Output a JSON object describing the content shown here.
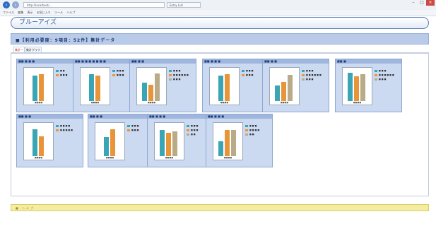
{
  "browser": {
    "address": "http://localhost/...",
    "tab_label": "Entry List",
    "menu": [
      "ファイル",
      "編集",
      "表示",
      "お気に入り",
      "ツール",
      "ヘルプ"
    ]
  },
  "app": {
    "title": "ブルーアイズ",
    "section_title": "■【利用必要度：9項目：52件】集計データ",
    "tabs": [
      "集計一覧",
      "集計グラフ"
    ],
    "footer_label": "■ ヘルプ"
  },
  "colors": [
    "#3aa6b5",
    "#e8953a",
    "#b9aa88"
  ],
  "cards": [
    {
      "title": "■■ ■ ■ ■",
      "values": [
        0.82,
        0.86
      ],
      "legend": [
        "■ ■",
        "■ ■ ■"
      ],
      "xlabel": "■■■■"
    },
    {
      "title": "■■ ■ ■ ■ ■ ■ ■ ■",
      "values": [
        0.86,
        0.82
      ],
      "legend": [
        "■ ■ ■",
        "■ ■ ■"
      ],
      "xlabel": "■■■■"
    },
    {
      "title": "■■ ■ ■",
      "values": [
        0.6,
        0.52,
        0.88
      ],
      "legend": [
        "■ ■ ■",
        "■ ■ ■ ■ ■ ■",
        "■ ■ ■"
      ],
      "xlabel": "■■■■"
    },
    {
      "title": "■■ ■ ■ ■",
      "values": [
        0.82,
        0.86
      ],
      "legend": [
        "■ ■ ■",
        "■ ■ ■"
      ],
      "xlabel": "■■■■"
    },
    {
      "title": "■■ ■ ■",
      "values": [
        0.5,
        0.62,
        0.84
      ],
      "legend": [
        "■ ■ ■",
        "■ ■ ■ ■ ■ ■",
        "■ ■ ■"
      ],
      "xlabel": "■■■■"
    },
    {
      "title": "■■ ■",
      "values": [
        0.9,
        0.8,
        0.86
      ],
      "legend": [
        "■ ■ ■",
        "■ ■ ■ ■ ■ ■",
        "■ ■ ■"
      ],
      "xlabel": "■■■■"
    },
    {
      "title": "■■ ■ ■",
      "values": [
        0.86,
        0.64
      ],
      "legend": [
        "■ ■ ■ ■",
        "■ ■ ■ ■ ■"
      ],
      "xlabel": "■■■■"
    },
    {
      "title": "■■ ■ ■",
      "values": [
        0.62,
        0.86
      ],
      "legend": [
        "■ ■ ■",
        "■ ■ ■"
      ],
      "xlabel": "■■■■"
    },
    {
      "title": "■■ ■ ■ ■",
      "values": [
        0.84,
        0.74,
        0.8
      ],
      "legend": [
        "■ ■ ■",
        "■ ■ ■",
        "■ ■"
      ],
      "xlabel": "■■■■"
    },
    {
      "title": "■■ ■ ■ ■",
      "values": [
        0.48,
        0.84,
        0.84
      ],
      "legend": [
        "■ ■ ■",
        "■ ■ ■ ■",
        "■ ■"
      ],
      "xlabel": "■■■■"
    }
  ]
}
